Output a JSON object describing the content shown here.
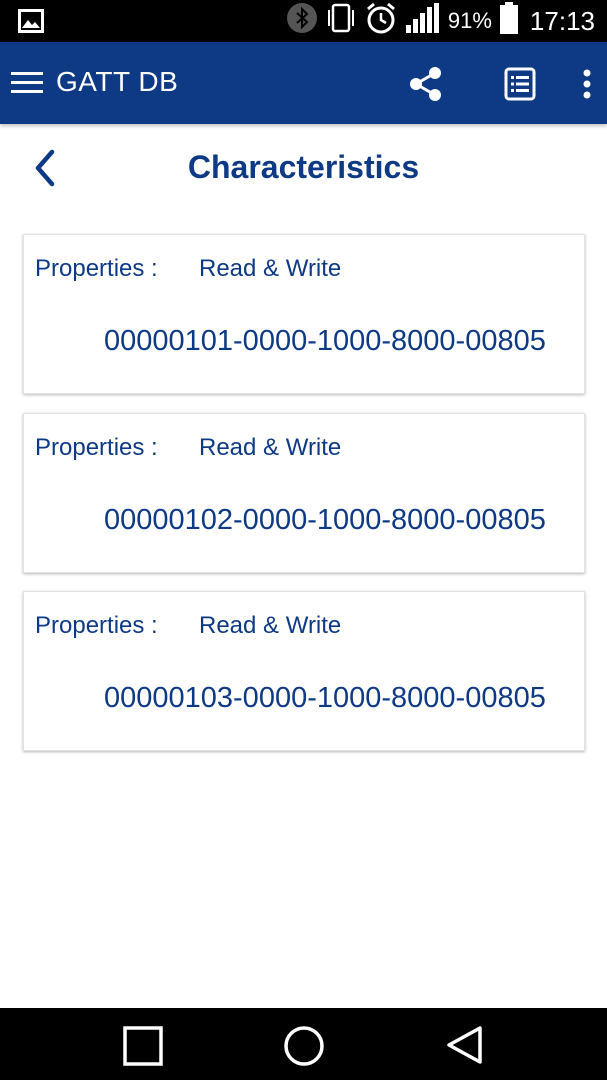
{
  "status_bar": {
    "battery_percent": "91%",
    "time": "17:13"
  },
  "app_bar": {
    "title": "GATT DB"
  },
  "page": {
    "title": "Characteristics"
  },
  "characteristics": [
    {
      "label": "Properties :",
      "value": "Read & Write",
      "uuid": "00000101-0000-1000-8000-00805"
    },
    {
      "label": "Properties :",
      "value": "Read & Write",
      "uuid": "00000102-0000-1000-8000-00805"
    },
    {
      "label": "Properties :",
      "value": "Read & Write",
      "uuid": "00000103-0000-1000-8000-00805"
    }
  ],
  "colors": {
    "brand_blue": "#0e3a85",
    "status_bar": "#000000"
  }
}
